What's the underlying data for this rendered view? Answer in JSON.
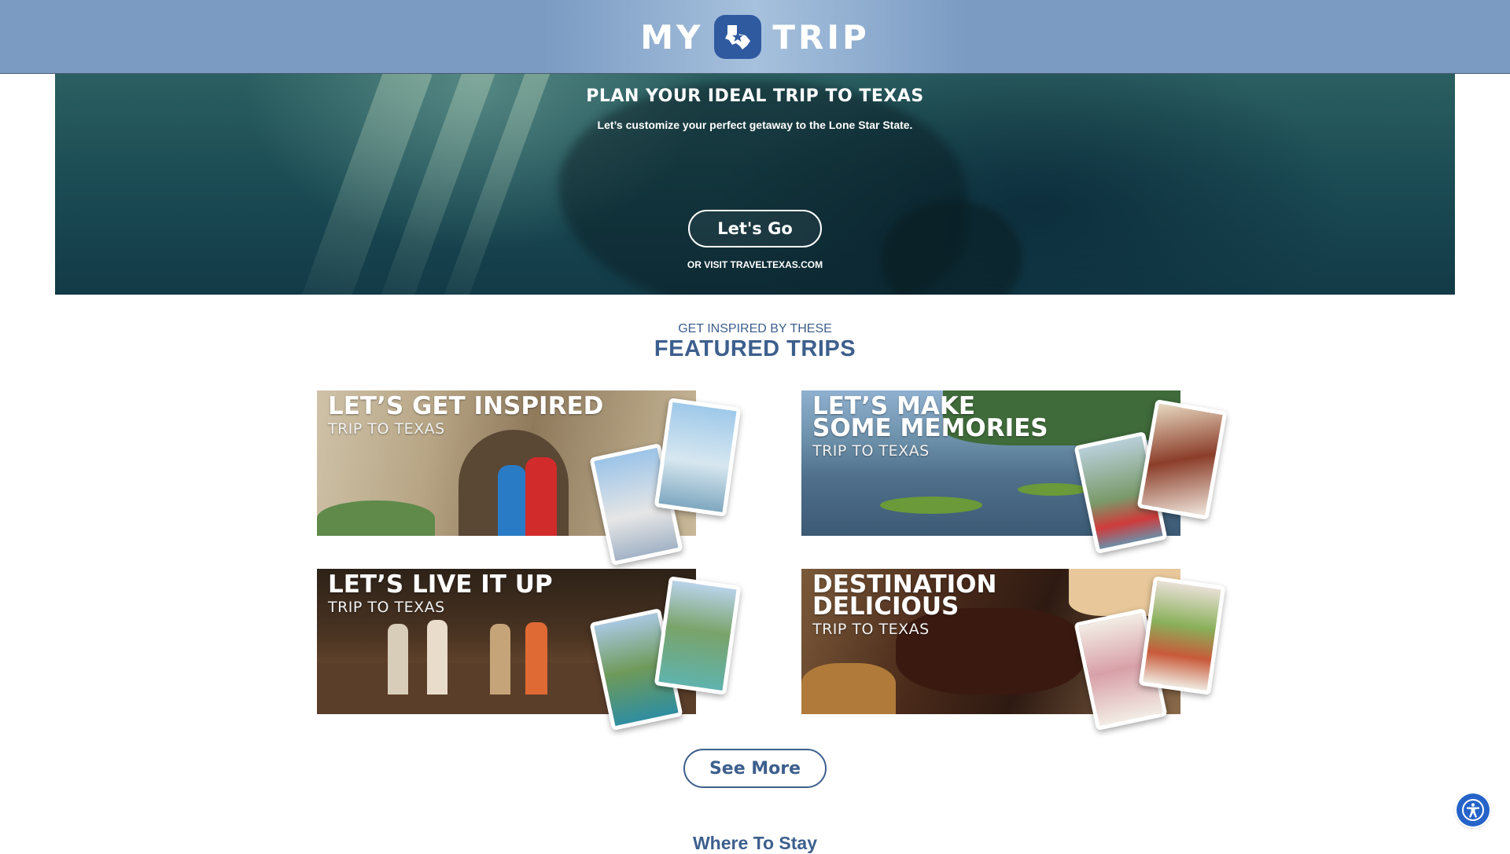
{
  "header": {
    "logo_left": "MY",
    "logo_right": "TRIP",
    "logo_icon": "texas-star-icon"
  },
  "hero": {
    "title": "PLAN YOUR IDEAL TRIP TO TEXAS",
    "subtitle": "Let’s customize your perfect getaway to the Lone Star State.",
    "button_label": "Let's Go",
    "secondary_link": "OR VISIT TRAVELTEXAS.COM"
  },
  "featured": {
    "kicker": "GET INSPIRED BY THESE",
    "title": "FEATURED TRIPS",
    "cards": [
      {
        "title": "LET’S GET INSPIRED",
        "subtitle": "TRIP TO TEXAS"
      },
      {
        "title": "LET’S MAKE\nSOME MEMORIES",
        "subtitle": "TRIP TO TEXAS"
      },
      {
        "title": "LET’S LIVE IT UP",
        "subtitle": "TRIP TO TEXAS"
      },
      {
        "title": "DESTINATION\nDELICIOUS",
        "subtitle": "TRIP TO TEXAS"
      }
    ],
    "see_more_label": "See More"
  },
  "next_section": {
    "title": "Where To Stay"
  },
  "accessibility": {
    "icon": "accessibility-icon"
  },
  "colors": {
    "brand_blue": "#3d5f8d",
    "header_blue": "#7b9bc3",
    "badge_blue": "#2f5aa0"
  }
}
